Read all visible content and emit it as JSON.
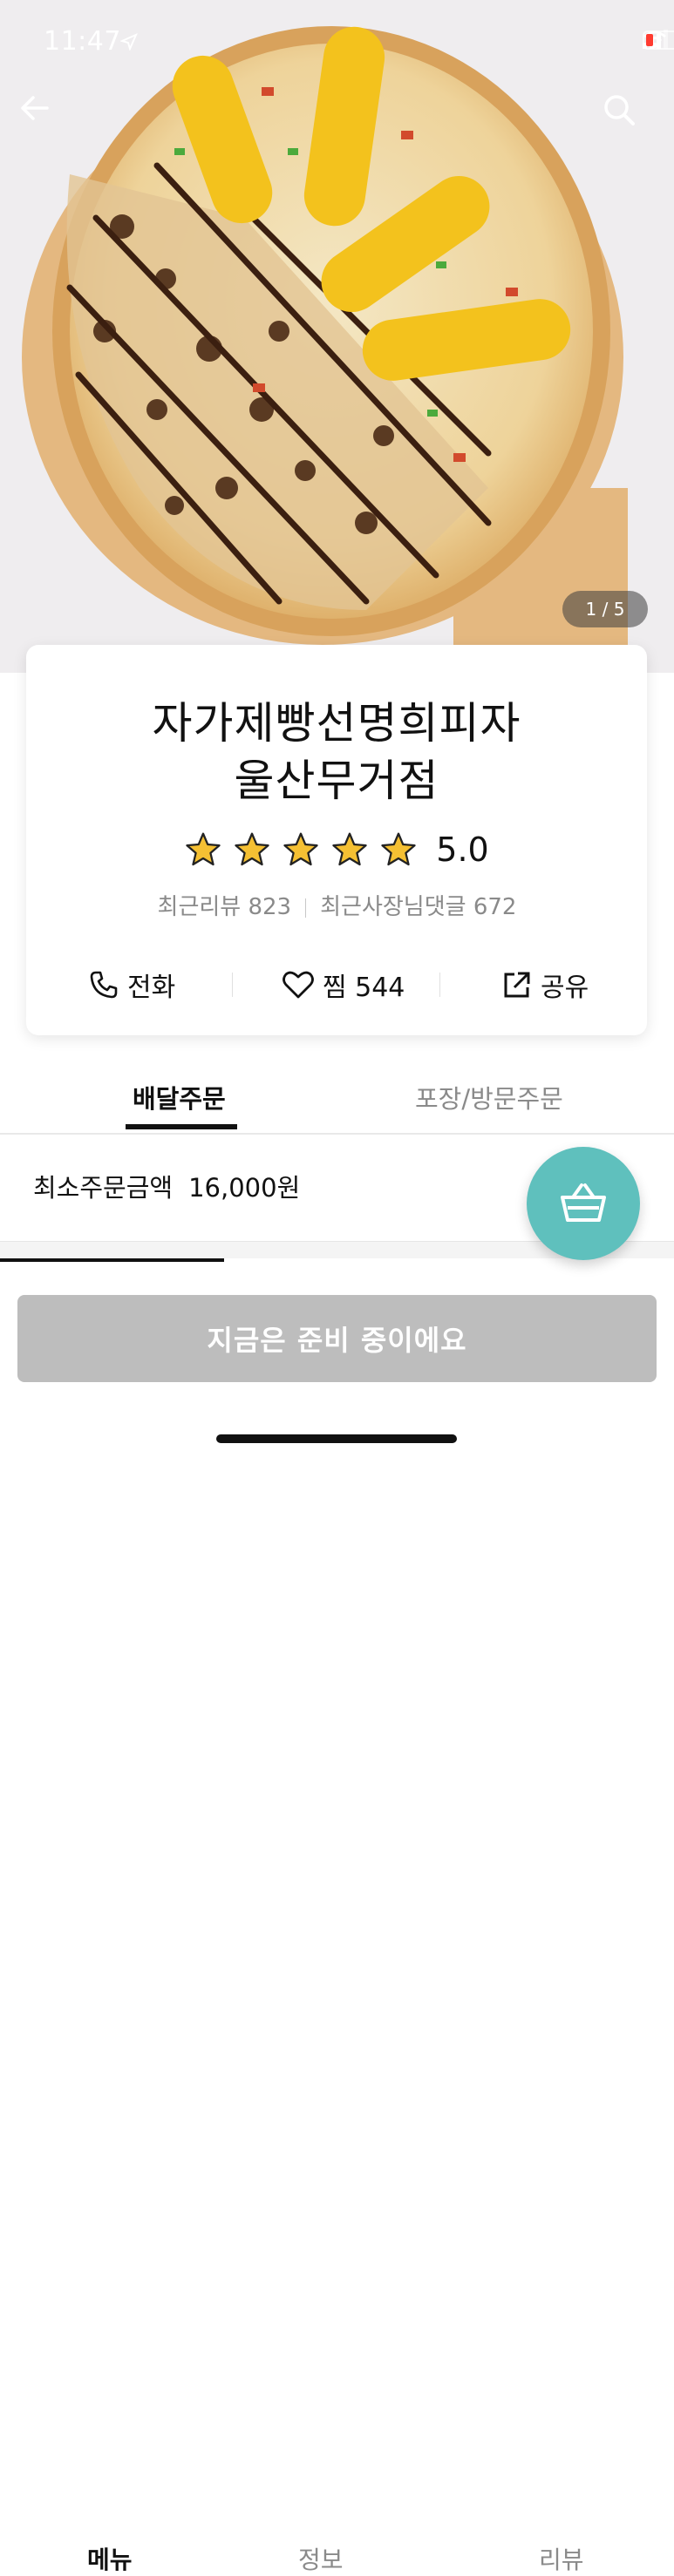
{
  "status_bar": {
    "time": "11:47"
  },
  "hero": {
    "image_description": "pizza-photo",
    "page_counter": "1 / 5"
  },
  "store": {
    "name_line1": "자가제빵선명희피자",
    "name_line2": "울산무거점",
    "rating": "5.0",
    "stars": 5,
    "reviews_label": "최근리뷰 823",
    "owner_replies_label": "최근사장님댓글 672"
  },
  "actions": {
    "call_label": "전화",
    "like_label": "찜 544",
    "share_label": "공유"
  },
  "order_tabs": {
    "delivery_label": "배달주문",
    "pickup_label": "포장/방문주문"
  },
  "min_order": {
    "label": "최소주문금액",
    "amount": "16,000원"
  },
  "sub_tabs": {
    "menu_label": "메뉴",
    "info_label": "정보",
    "review_label": "리뷰"
  },
  "status_button": {
    "label": "지금은 준비 중이에요"
  },
  "colors": {
    "accent_teal": "#5fc0bd",
    "star_fill": "#f5c033",
    "disabled_button": "#bdbdbd"
  }
}
